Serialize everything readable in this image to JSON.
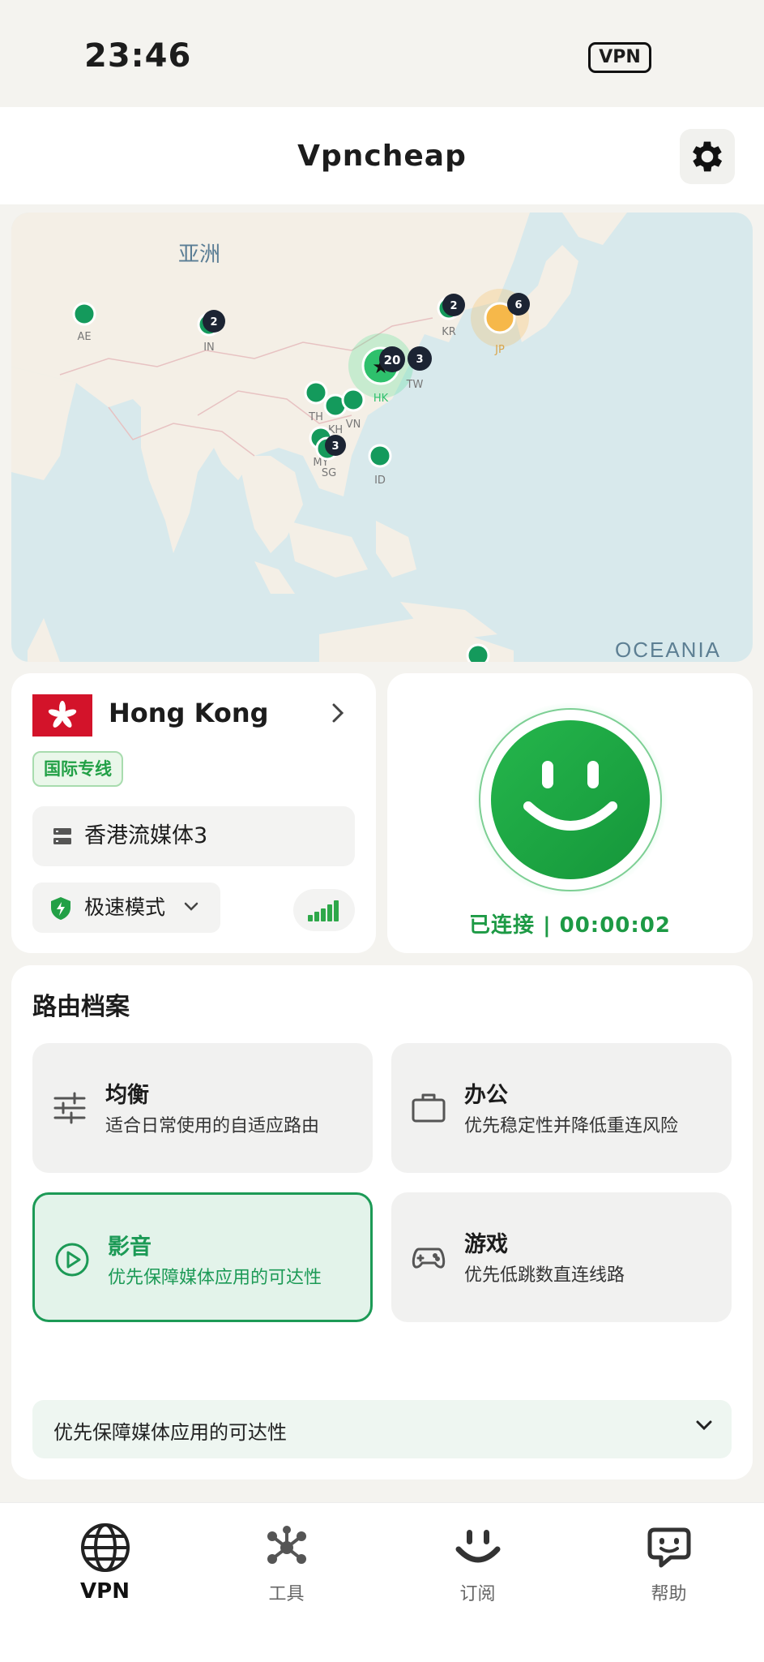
{
  "status_bar": {
    "time": "23:46",
    "vpn_badge": "VPN"
  },
  "header": {
    "title": "Vpncheap"
  },
  "map": {
    "region_label": "亚洲",
    "ocean_label": "OCEANIA",
    "markers": [
      {
        "code": "AE",
        "count": ""
      },
      {
        "code": "IN",
        "count": "2"
      },
      {
        "code": "TH",
        "count": ""
      },
      {
        "code": "KH",
        "count": ""
      },
      {
        "code": "VN",
        "count": ""
      },
      {
        "code": "MY",
        "count": ""
      },
      {
        "code": "SG",
        "count": "3"
      },
      {
        "code": "ID",
        "count": ""
      },
      {
        "code": "HK",
        "count": "20"
      },
      {
        "code": "TW",
        "count": "3"
      },
      {
        "code": "KR",
        "count": "2"
      },
      {
        "code": "JP",
        "count": "6"
      }
    ]
  },
  "location": {
    "country": "Hong Kong",
    "tag": "国际专线",
    "server": "香港流媒体3",
    "mode": "极速模式"
  },
  "connection": {
    "status": "已连接 | 00:00:02"
  },
  "routing": {
    "title": "路由档案",
    "options": [
      {
        "name": "均衡",
        "desc": "适合日常使用的自适应路由"
      },
      {
        "name": "办公",
        "desc": "优先稳定性并降低重连风险"
      },
      {
        "name": "影音",
        "desc": "优先保障媒体应用的可达性"
      },
      {
        "name": "游戏",
        "desc": "优先低跳数直连线路"
      }
    ],
    "selected_desc": "优先保障媒体应用的可达性"
  },
  "tabs": [
    {
      "label": "VPN"
    },
    {
      "label": "工具"
    },
    {
      "label": "订阅"
    },
    {
      "label": "帮助"
    }
  ],
  "colors": {
    "accent": "#1c9a56",
    "connect": "#1fa040",
    "marker": "#149a5c",
    "jp_marker": "#f6b84a"
  }
}
